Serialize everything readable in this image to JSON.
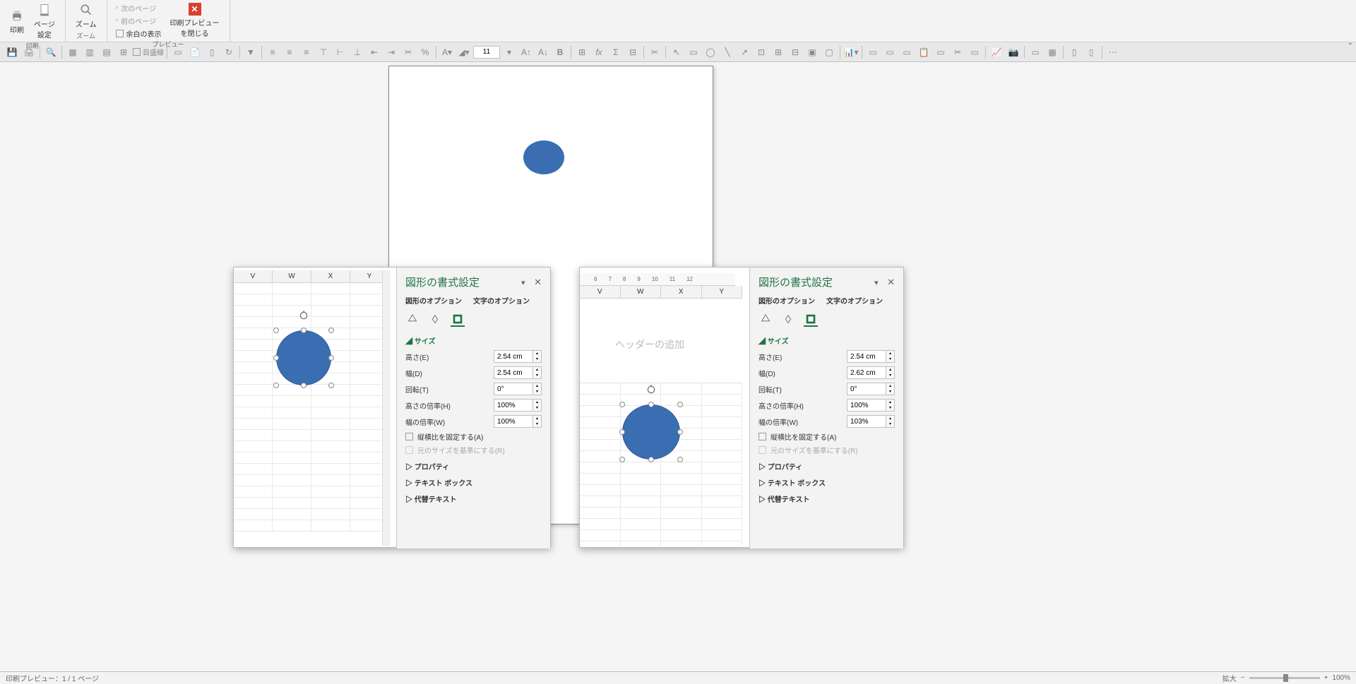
{
  "ribbon": {
    "print": "印刷",
    "page_setup": "ページ\n設定",
    "zoom": "ズーム",
    "next_page": "次のページ",
    "prev_page": "前のページ",
    "show_margins": "余白の表示",
    "close_preview": "印刷プレビュー\nを閉じる",
    "group_print": "印刷",
    "group_zoom": "ズーム",
    "group_preview": "プレビュー"
  },
  "toolbar": {
    "font_size": "11",
    "gridlines": "目盛線"
  },
  "columns_left": [
    "V",
    "W",
    "X",
    "Y"
  ],
  "columns_right": [
    "V",
    "W",
    "X",
    "Y"
  ],
  "ruler_marks": [
    "6",
    "7",
    "8",
    "9",
    "10",
    "11",
    "12"
  ],
  "header_placeholder": "ヘッダーの追加",
  "pane_left": {
    "title": "図形の書式設定",
    "tab1": "図形のオプション",
    "tab2": "文字のオプション",
    "section_size": "サイズ",
    "height_label": "高さ(E)",
    "height_val": "2.54 cm",
    "width_label": "幅(D)",
    "width_val": "2.54 cm",
    "rotation_label": "回転(T)",
    "rotation_val": "0°",
    "scale_h_label": "高さの倍率(H)",
    "scale_h_val": "100%",
    "scale_w_label": "幅の倍率(W)",
    "scale_w_val": "100%",
    "lock_aspect": "縦横比を固定する(A)",
    "rel_original": "元のサイズを基準にする(R)",
    "section_props": "プロパティ",
    "section_textbox": "テキスト ボックス",
    "section_alttext": "代替テキスト"
  },
  "pane_right": {
    "title": "図形の書式設定",
    "tab1": "図形のオプション",
    "tab2": "文字のオプション",
    "section_size": "サイズ",
    "height_label": "高さ(E)",
    "height_val": "2.54 cm",
    "width_label": "幅(D)",
    "width_val": "2.62 cm",
    "rotation_label": "回転(T)",
    "rotation_val": "0°",
    "scale_h_label": "高さの倍率(H)",
    "scale_h_val": "100%",
    "scale_w_label": "幅の倍率(W)",
    "scale_w_val": "103%",
    "lock_aspect": "縦横比を固定する(A)",
    "rel_original": "元のサイズを基準にする(R)",
    "section_props": "プロパティ",
    "section_textbox": "テキスト ボックス",
    "section_alttext": "代替テキスト"
  },
  "status": {
    "left": "印刷プレビュー：1 / 1 ページ",
    "zoom_label": "拡大",
    "zoom_pct": "100%"
  }
}
